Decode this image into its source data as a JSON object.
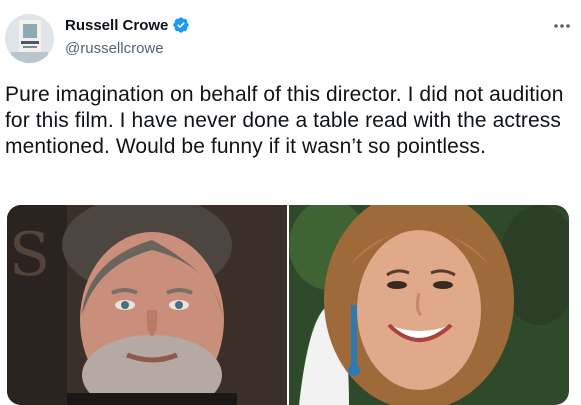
{
  "author": {
    "display_name": "Russell Crowe",
    "handle": "@russellcrowe",
    "verified": true,
    "avatar_icon": "profile-photo"
  },
  "tweet": {
    "text": "Pure imagination on behalf of this director. I did not audition for this film. I have never done a table read with the actress mentioned. Would be funny if it wasn’t so pointless."
  },
  "media": [
    {
      "icon": "photo-man-gray-beard"
    },
    {
      "icon": "photo-woman-smiling"
    }
  ],
  "colors": {
    "verified_blue": "#1d9bf0",
    "handle_gray": "#536471",
    "text": "#0f1419"
  }
}
